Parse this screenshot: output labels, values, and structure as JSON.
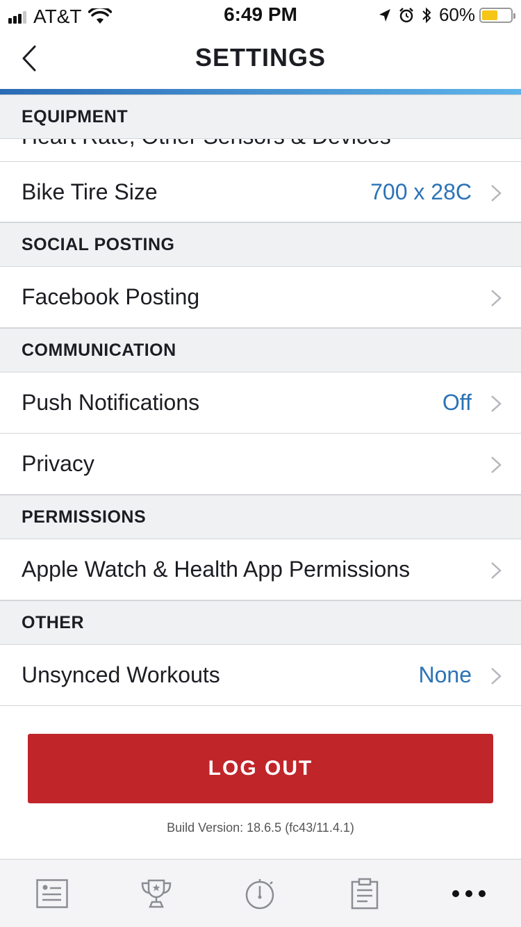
{
  "status_bar": {
    "carrier": "AT&T",
    "time": "6:49 PM",
    "battery_percent": "60%",
    "battery_level": 0.6,
    "icons": [
      "signal-icon",
      "wifi-icon",
      "location-icon",
      "alarm-icon",
      "bluetooth-icon",
      "battery-icon"
    ]
  },
  "nav": {
    "title": "SETTINGS",
    "back_icon": "chevron-left-icon"
  },
  "sections": {
    "equipment": {
      "header": "EQUIPMENT",
      "partial_item": "Heart Rate, Other Sensors & Devices",
      "items": [
        {
          "label": "Bike Tire Size",
          "value": "700 x 28C"
        }
      ]
    },
    "social_posting": {
      "header": "SOCIAL POSTING",
      "items": [
        {
          "label": "Facebook Posting",
          "value": ""
        }
      ]
    },
    "communication": {
      "header": "COMMUNICATION",
      "items": [
        {
          "label": "Push Notifications",
          "value": "Off"
        },
        {
          "label": "Privacy",
          "value": ""
        }
      ]
    },
    "permissions": {
      "header": "PERMISSIONS",
      "items": [
        {
          "label": "Apple Watch & Health App Permissions",
          "value": ""
        }
      ]
    },
    "other": {
      "header": "OTHER",
      "items": [
        {
          "label": "Unsynced Workouts",
          "value": "None"
        }
      ]
    }
  },
  "logout": {
    "label": "LOG OUT"
  },
  "build_version": "Build Version: 18.6.5 (fc43/11.4.1)",
  "tab_bar": {
    "icons": [
      "feed-icon",
      "trophy-icon",
      "stopwatch-icon",
      "clipboard-icon",
      "more-icon"
    ]
  },
  "colors": {
    "accent_blue": "#2b73b6",
    "logout_red": "#c0252a",
    "gradient_start": "#2b6cb5",
    "gradient_end": "#5fb4ea",
    "section_bg": "#f0f1f3"
  }
}
